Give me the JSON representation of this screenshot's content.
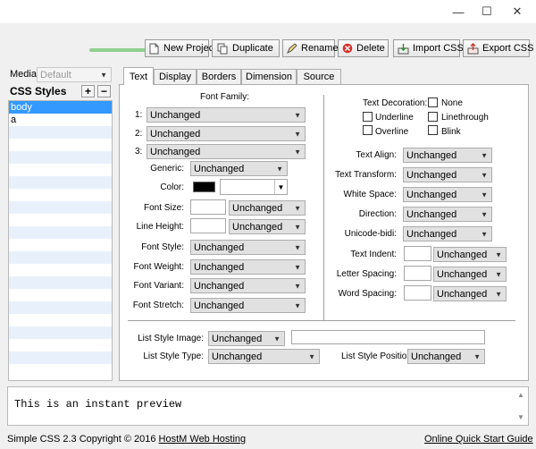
{
  "window": {
    "minimize_glyph": "—",
    "maximize_glyph": "☐",
    "close_glyph": "✕"
  },
  "toolbar": {
    "new_project": "New Project",
    "duplicate": "Duplicate",
    "rename": "Rename",
    "delete": "Delete",
    "import_css": "Import CSS",
    "export_css": "Export CSS",
    "progress": 1.0
  },
  "left": {
    "media_label": "Media:",
    "media_value": "Default",
    "styles_label": "CSS Styles",
    "add_glyph": "+",
    "remove_glyph": "−",
    "items": [
      "body",
      "a"
    ]
  },
  "tabs": [
    "Text",
    "Display",
    "Borders",
    "Dimension",
    "Source"
  ],
  "text_tab": {
    "font_family_label": "Font Family:",
    "ff1_label": "1:",
    "ff1_value": "Unchanged",
    "ff2_label": "2:",
    "ff2_value": "Unchanged",
    "ff3_label": "3:",
    "ff3_value": "Unchanged",
    "generic_label": "Generic:",
    "generic_value": "Unchanged",
    "color_label": "Color:",
    "color_value": "#000000",
    "font_size_label": "Font Size:",
    "font_size_unit": "Unchanged",
    "line_height_label": "Line Height:",
    "line_height_unit": "Unchanged",
    "font_style_label": "Font Style:",
    "font_style_value": "Unchanged",
    "font_weight_label": "Font Weight:",
    "font_weight_value": "Unchanged",
    "font_variant_label": "Font Variant:",
    "font_variant_value": "Unchanged",
    "font_stretch_label": "Font Stretch:",
    "font_stretch_value": "Unchanged",
    "text_decoration_label": "Text Decoration:",
    "deco_none": "None",
    "deco_underline": "Underline",
    "deco_linethrough": "Linethrough",
    "deco_overline": "Overline",
    "deco_blink": "Blink",
    "text_align_label": "Text Align:",
    "text_align_value": "Unchanged",
    "text_transform_label": "Text Transform:",
    "text_transform_value": "Unchanged",
    "white_space_label": "White Space:",
    "white_space_value": "Unchanged",
    "direction_label": "Direction:",
    "direction_value": "Unchanged",
    "unicode_bidi_label": "Unicode-bidi:",
    "unicode_bidi_value": "Unchanged",
    "text_indent_label": "Text Indent:",
    "text_indent_unit": "Unchanged",
    "letter_spacing_label": "Letter Spacing:",
    "letter_spacing_unit": "Unchanged",
    "word_spacing_label": "Word Spacing:",
    "word_spacing_unit": "Unchanged",
    "list_style_image_label": "List Style Image:",
    "list_style_image_value": "Unchanged",
    "list_style_type_label": "List Style Type:",
    "list_style_type_value": "Unchanged",
    "list_style_position_label": "List Style Position:",
    "list_style_position_value": "Unchanged"
  },
  "preview": {
    "text": "This is an instant preview"
  },
  "status": {
    "app_name": "Simple CSS",
    "copyright": "2.3 Copyright © 2016",
    "company": "HostM Web Hosting",
    "quick_start": "Online Quick Start Guide"
  }
}
